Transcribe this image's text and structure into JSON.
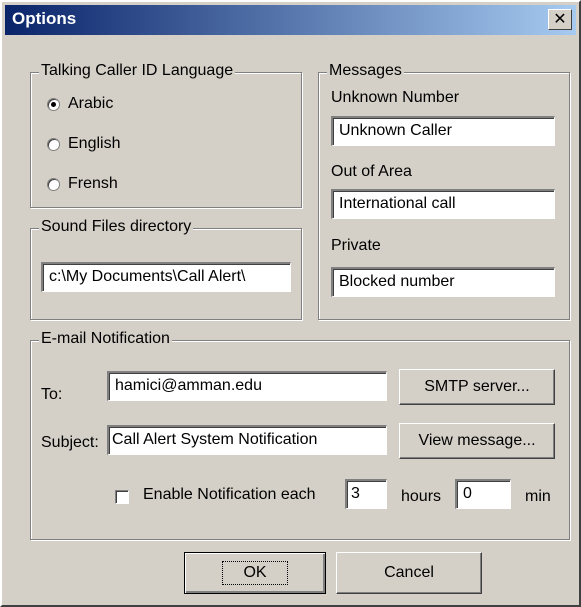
{
  "window": {
    "title": "Options",
    "close_glyph": "✕",
    "colors": {
      "titlebar_start": "#0a246a",
      "titlebar_end": "#a6caf0",
      "face": "#d4d0c8"
    }
  },
  "language_group": {
    "legend": "Talking Caller ID Language",
    "options": [
      {
        "label": "Arabic",
        "selected": true
      },
      {
        "label": "English",
        "selected": false
      },
      {
        "label": "Frensh",
        "selected": false
      }
    ]
  },
  "sound_group": {
    "legend": "Sound Files directory",
    "path_value": "c:\\My Documents\\Call Alert\\"
  },
  "messages_group": {
    "legend": "Messages",
    "unknown_label": "Unknown Number",
    "unknown_value": "Unknown Caller",
    "out_of_area_label": "Out of Area",
    "out_of_area_value": "International call",
    "private_label": "Private",
    "private_value": "Blocked number"
  },
  "email_group": {
    "legend": "E-mail Notification",
    "to_label": "To:",
    "to_value": "hamici@amman.edu",
    "smtp_button": "SMTP server...",
    "subject_label": "Subject:",
    "subject_value": "Call Alert System Notification",
    "view_button": "View message...",
    "enable_label": "Enable Notification each",
    "enable_checked": false,
    "hours_value": "3",
    "hours_label": "hours",
    "min_value": "0",
    "min_label": "min"
  },
  "footer": {
    "ok_label": "OK",
    "cancel_label": "Cancel"
  }
}
